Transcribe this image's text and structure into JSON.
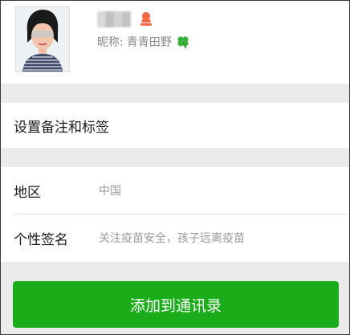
{
  "profile": {
    "name": "",
    "nickname_label": "昵称:",
    "nickname": "青青田野",
    "gender_icon": "female-person-icon",
    "nickname_emoji": "four-leaf-clover-icon"
  },
  "remark": {
    "label": "设置备注和标签"
  },
  "info": {
    "region_label": "地区",
    "region_value": "中国",
    "signature_label": "个性签名",
    "signature_value": "关注疫苗安全，孩子远离疫苗"
  },
  "actions": {
    "add_contact_label": "添加到通讯录"
  },
  "colors": {
    "accent_green": "#1aad19",
    "gender_orange": "#f26a43",
    "clover_green": "#3ab13a",
    "background": "#ebebeb"
  }
}
